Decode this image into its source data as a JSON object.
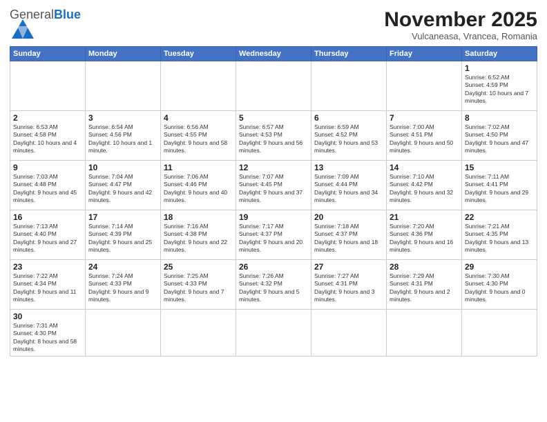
{
  "header": {
    "logo_general": "General",
    "logo_blue": "Blue",
    "month_title": "November 2025",
    "location": "Vulcaneasa, Vrancea, Romania"
  },
  "weekdays": [
    "Sunday",
    "Monday",
    "Tuesday",
    "Wednesday",
    "Thursday",
    "Friday",
    "Saturday"
  ],
  "days": [
    {
      "date": "",
      "info": ""
    },
    {
      "date": "",
      "info": ""
    },
    {
      "date": "",
      "info": ""
    },
    {
      "date": "",
      "info": ""
    },
    {
      "date": "",
      "info": ""
    },
    {
      "date": "",
      "info": ""
    },
    {
      "date": "1",
      "info": "Sunrise: 6:52 AM\nSunset: 4:59 PM\nDaylight: 10 hours and 7 minutes."
    },
    {
      "date": "2",
      "info": "Sunrise: 6:53 AM\nSunset: 4:58 PM\nDaylight: 10 hours and 4 minutes."
    },
    {
      "date": "3",
      "info": "Sunrise: 6:54 AM\nSunset: 4:56 PM\nDaylight: 10 hours and 1 minute."
    },
    {
      "date": "4",
      "info": "Sunrise: 6:56 AM\nSunset: 4:55 PM\nDaylight: 9 hours and 58 minutes."
    },
    {
      "date": "5",
      "info": "Sunrise: 6:57 AM\nSunset: 4:53 PM\nDaylight: 9 hours and 56 minutes."
    },
    {
      "date": "6",
      "info": "Sunrise: 6:59 AM\nSunset: 4:52 PM\nDaylight: 9 hours and 53 minutes."
    },
    {
      "date": "7",
      "info": "Sunrise: 7:00 AM\nSunset: 4:51 PM\nDaylight: 9 hours and 50 minutes."
    },
    {
      "date": "8",
      "info": "Sunrise: 7:02 AM\nSunset: 4:50 PM\nDaylight: 9 hours and 47 minutes."
    },
    {
      "date": "9",
      "info": "Sunrise: 7:03 AM\nSunset: 4:48 PM\nDaylight: 9 hours and 45 minutes."
    },
    {
      "date": "10",
      "info": "Sunrise: 7:04 AM\nSunset: 4:47 PM\nDaylight: 9 hours and 42 minutes."
    },
    {
      "date": "11",
      "info": "Sunrise: 7:06 AM\nSunset: 4:46 PM\nDaylight: 9 hours and 40 minutes."
    },
    {
      "date": "12",
      "info": "Sunrise: 7:07 AM\nSunset: 4:45 PM\nDaylight: 9 hours and 37 minutes."
    },
    {
      "date": "13",
      "info": "Sunrise: 7:09 AM\nSunset: 4:44 PM\nDaylight: 9 hours and 34 minutes."
    },
    {
      "date": "14",
      "info": "Sunrise: 7:10 AM\nSunset: 4:42 PM\nDaylight: 9 hours and 32 minutes."
    },
    {
      "date": "15",
      "info": "Sunrise: 7:11 AM\nSunset: 4:41 PM\nDaylight: 9 hours and 29 minutes."
    },
    {
      "date": "16",
      "info": "Sunrise: 7:13 AM\nSunset: 4:40 PM\nDaylight: 9 hours and 27 minutes."
    },
    {
      "date": "17",
      "info": "Sunrise: 7:14 AM\nSunset: 4:39 PM\nDaylight: 9 hours and 25 minutes."
    },
    {
      "date": "18",
      "info": "Sunrise: 7:16 AM\nSunset: 4:38 PM\nDaylight: 9 hours and 22 minutes."
    },
    {
      "date": "19",
      "info": "Sunrise: 7:17 AM\nSunset: 4:37 PM\nDaylight: 9 hours and 20 minutes."
    },
    {
      "date": "20",
      "info": "Sunrise: 7:18 AM\nSunset: 4:37 PM\nDaylight: 9 hours and 18 minutes."
    },
    {
      "date": "21",
      "info": "Sunrise: 7:20 AM\nSunset: 4:36 PM\nDaylight: 9 hours and 16 minutes."
    },
    {
      "date": "22",
      "info": "Sunrise: 7:21 AM\nSunset: 4:35 PM\nDaylight: 9 hours and 13 minutes."
    },
    {
      "date": "23",
      "info": "Sunrise: 7:22 AM\nSunset: 4:34 PM\nDaylight: 9 hours and 11 minutes."
    },
    {
      "date": "24",
      "info": "Sunrise: 7:24 AM\nSunset: 4:33 PM\nDaylight: 9 hours and 9 minutes."
    },
    {
      "date": "25",
      "info": "Sunrise: 7:25 AM\nSunset: 4:33 PM\nDaylight: 9 hours and 7 minutes."
    },
    {
      "date": "26",
      "info": "Sunrise: 7:26 AM\nSunset: 4:32 PM\nDaylight: 9 hours and 5 minutes."
    },
    {
      "date": "27",
      "info": "Sunrise: 7:27 AM\nSunset: 4:31 PM\nDaylight: 9 hours and 3 minutes."
    },
    {
      "date": "28",
      "info": "Sunrise: 7:29 AM\nSunset: 4:31 PM\nDaylight: 9 hours and 2 minutes."
    },
    {
      "date": "29",
      "info": "Sunrise: 7:30 AM\nSunset: 4:30 PM\nDaylight: 9 hours and 0 minutes."
    },
    {
      "date": "30",
      "info": "Sunrise: 7:31 AM\nSunset: 4:30 PM\nDaylight: 8 hours and 58 minutes."
    },
    {
      "date": "",
      "info": ""
    },
    {
      "date": "",
      "info": ""
    },
    {
      "date": "",
      "info": ""
    },
    {
      "date": "",
      "info": ""
    },
    {
      "date": "",
      "info": ""
    },
    {
      "date": "",
      "info": ""
    }
  ]
}
